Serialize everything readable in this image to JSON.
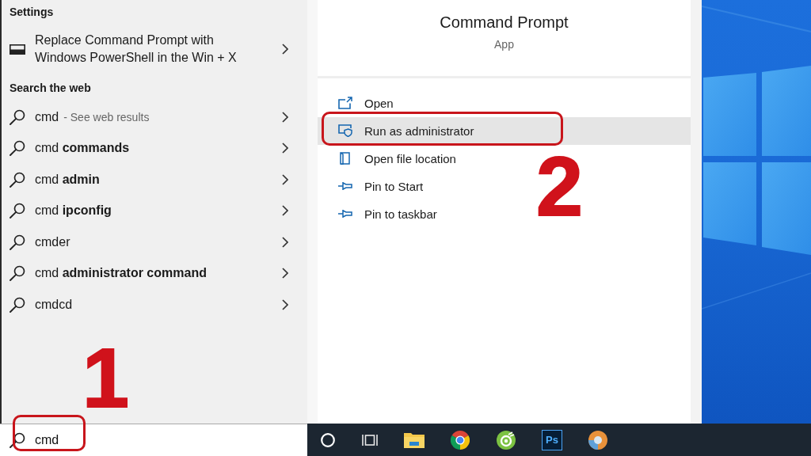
{
  "search_results": {
    "settings_heading": "Settings",
    "settings_item": {
      "text": "Replace Command Prompt with\nWindows PowerShell in the Win + X"
    },
    "web_heading": "Search the web",
    "web_items": [
      {
        "text": "cmd",
        "hint": "- See web results"
      },
      {
        "text": "cmd **commands**"
      },
      {
        "text": "cmd **admin**"
      },
      {
        "text": "cmd **ipconfig**"
      },
      {
        "text": "cmder"
      },
      {
        "text": "cmd **administrator command**"
      },
      {
        "text": "cmdcd"
      }
    ],
    "step_label": "1"
  },
  "app_details": {
    "title": "Command Prompt",
    "subtitle": "App",
    "actions": [
      {
        "kind": "open",
        "label": "Open",
        "selected": false,
        "outlined": false
      },
      {
        "kind": "admin",
        "label": "Run as administrator",
        "selected": true,
        "outlined": true
      },
      {
        "kind": "location",
        "label": "Open file location",
        "selected": false,
        "outlined": false
      },
      {
        "kind": "pin",
        "label": "Pin to Start",
        "selected": false,
        "outlined": false
      },
      {
        "kind": "pin",
        "label": "Pin to taskbar",
        "selected": false,
        "outlined": false
      }
    ],
    "step_label": "2"
  },
  "search_box": {
    "value": "cmd",
    "outlined": true
  },
  "taskbar": {
    "badge_text": "Ps"
  }
}
